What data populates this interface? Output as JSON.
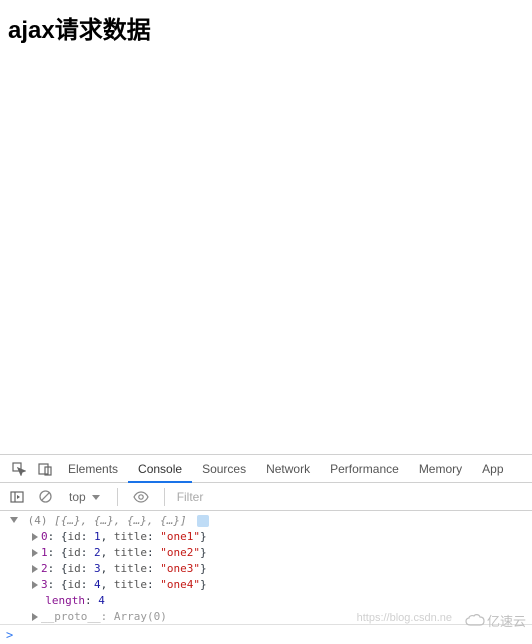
{
  "page": {
    "title": "ajax请求数据"
  },
  "devtools": {
    "tabs": {
      "elements": "Elements",
      "console": "Console",
      "sources": "Sources",
      "network": "Network",
      "performance": "Performance",
      "memory": "Memory",
      "application": "App"
    },
    "toolbar": {
      "context": "top",
      "filter_placeholder": "Filter"
    }
  },
  "console": {
    "summary_count": "(4)",
    "summary_preview": "[{…}, {…}, {…}, {…}]",
    "items": [
      {
        "idx": "0",
        "id": 1,
        "title": "one1"
      },
      {
        "idx": "1",
        "id": 2,
        "title": "one2"
      },
      {
        "idx": "2",
        "id": 3,
        "title": "one3"
      },
      {
        "idx": "3",
        "id": 4,
        "title": "one4"
      }
    ],
    "length_key": "length",
    "length_val": "4",
    "proto_key": "__proto__",
    "proto_val": "Array(0)",
    "prompt": ">"
  },
  "watermark": {
    "text": "https://blog.csdn.ne",
    "logo": "亿速云"
  }
}
